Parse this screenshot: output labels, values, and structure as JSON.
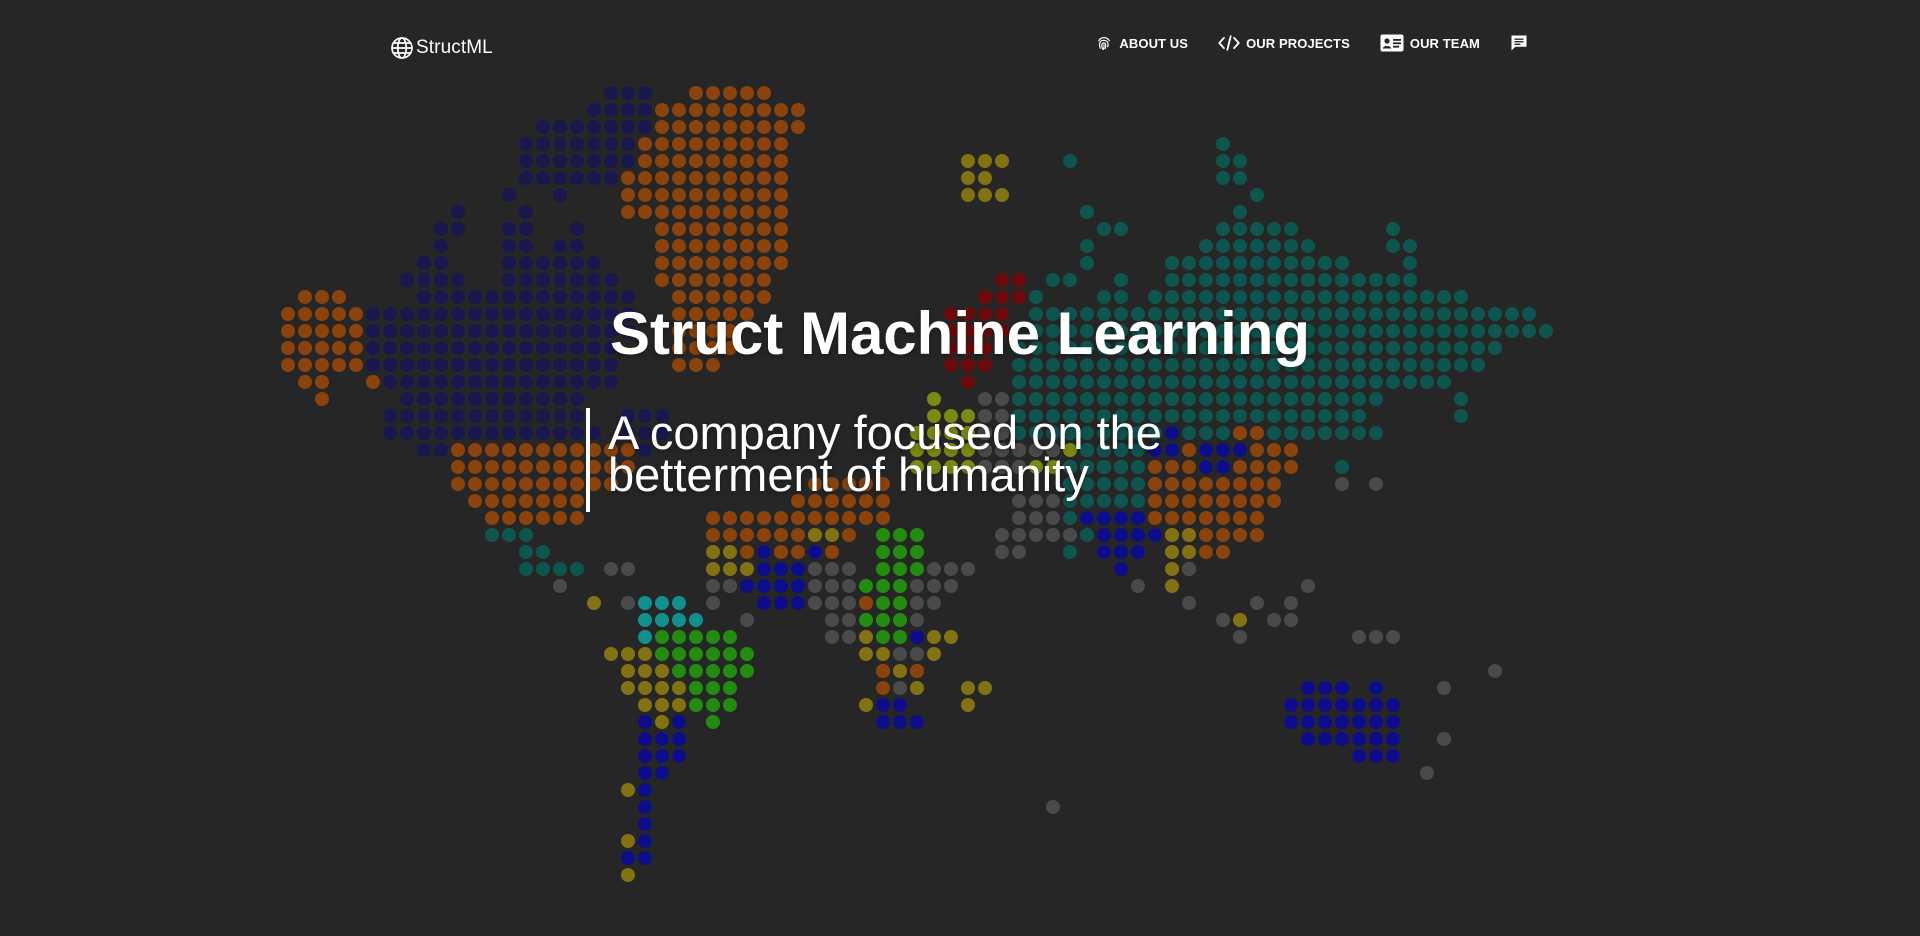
{
  "brand": {
    "name": "StructML",
    "icon": "globe-icon"
  },
  "nav": {
    "items": [
      {
        "label": "ABOUT US",
        "icon": "fingerprint-icon"
      },
      {
        "label": "OUR PROJECTS",
        "icon": "code-icon"
      },
      {
        "label": "OUR TEAM",
        "icon": "id-card-icon"
      },
      {
        "label": "",
        "icon": "chat-icon"
      }
    ]
  },
  "hero": {
    "title": "Struct Machine Learning",
    "subtitle_line1": "A company focused on the",
    "subtitle_line2": "betterment of humanity"
  },
  "colors": {
    "background": "#262626",
    "text": "#ffffff",
    "dot_palette": {
      "navy": "#18184f",
      "blue": "#0d0d8a",
      "orange": "#8a430c",
      "teal": "#0e5550",
      "cyan": "#12908f",
      "olive": "#827213",
      "lime": "#7c8a14",
      "green": "#238c10",
      "gray": "#4a4a4a",
      "red": "#6b0b0b"
    }
  },
  "map": {
    "description_icon": "dotted-world-map"
  }
}
